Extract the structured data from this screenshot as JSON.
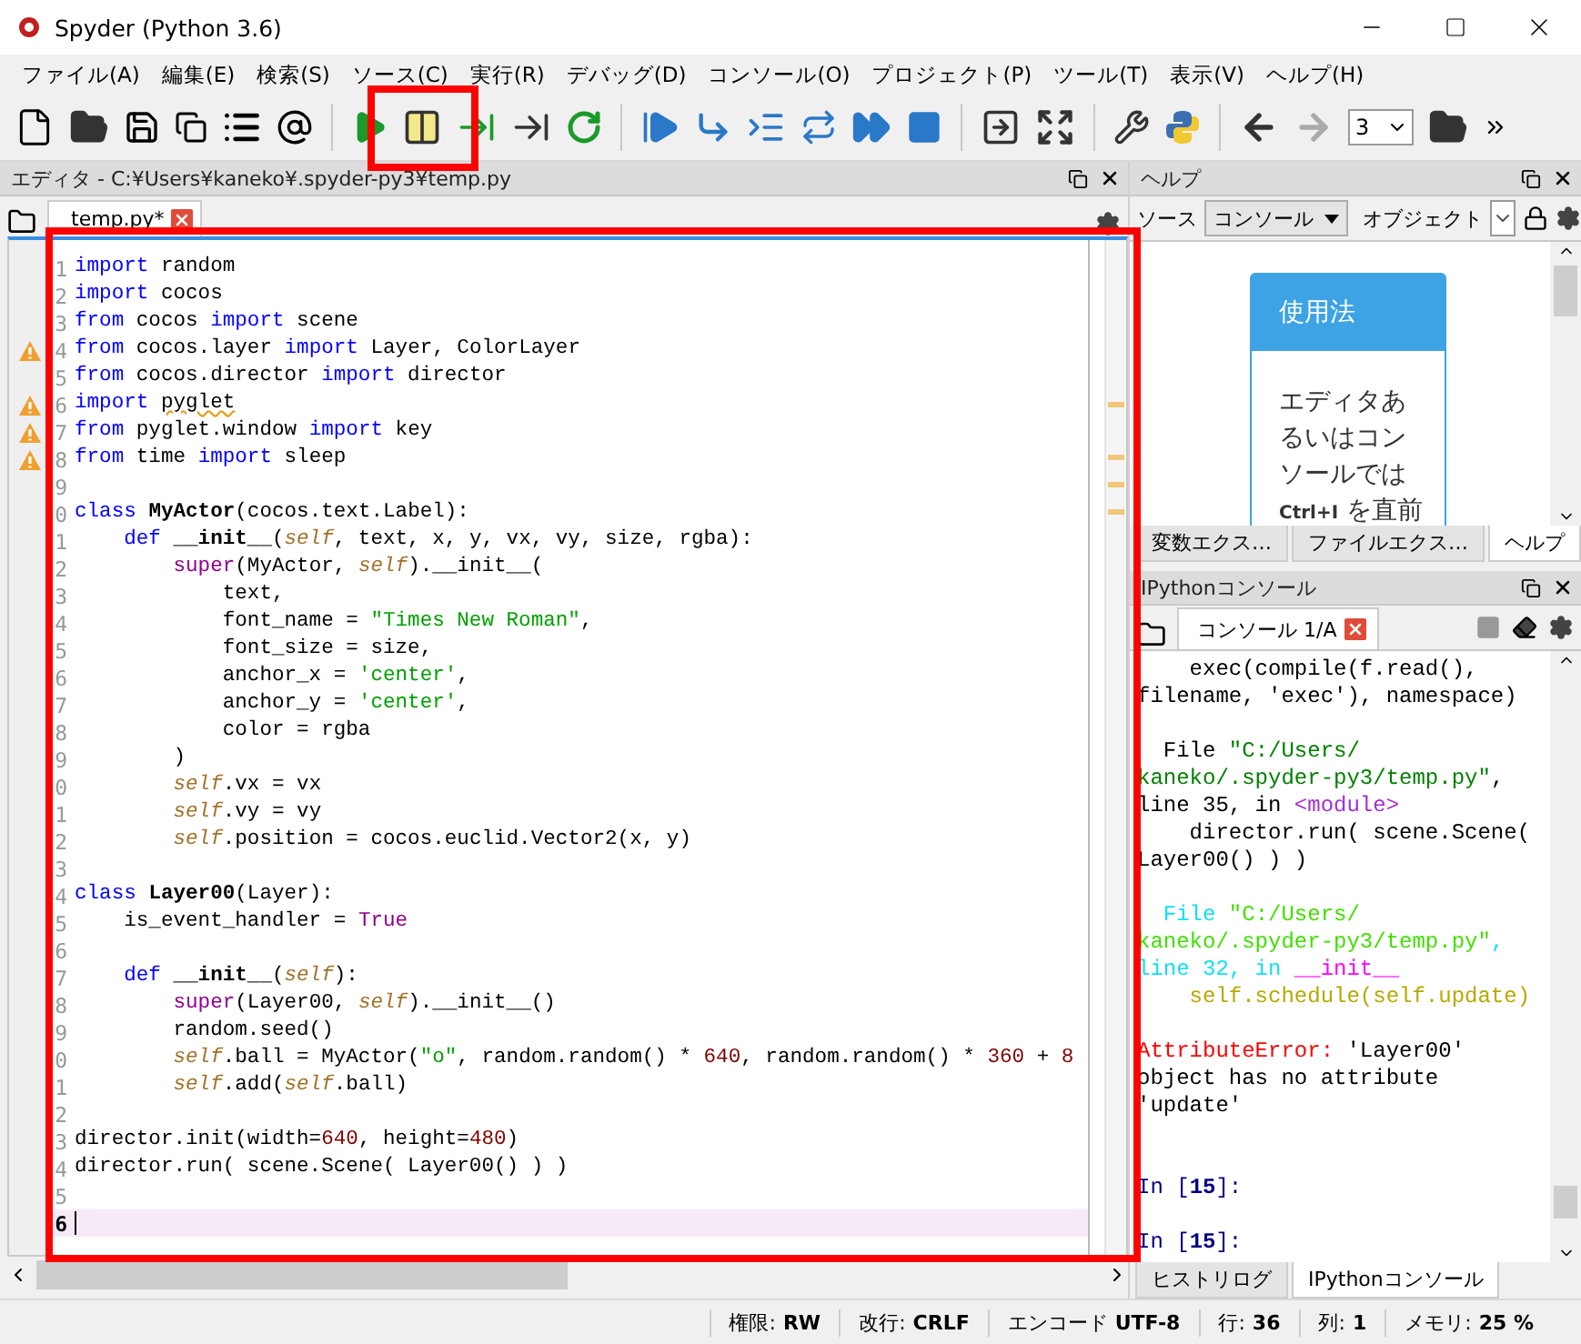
{
  "window": {
    "title": "Spyder (Python 3.6)"
  },
  "menus": [
    "ファイル(A)",
    "編集(E)",
    "検索(S)",
    "ソース(C)",
    "実行(R)",
    "デバッグ(D)",
    "コンソール(O)",
    "プロジェクト(P)",
    "ツール(T)",
    "表示(V)",
    "ヘルプ(H)"
  ],
  "toolbar": {
    "working_dir": "3"
  },
  "editor": {
    "title": "エディタ - C:¥Users¥kaneko¥.spyder-py3¥temp.py",
    "tabs": [
      {
        "label": "temp.py*",
        "selected": true
      }
    ],
    "lines": [
      {
        "number": "1",
        "warning": false,
        "current": false,
        "tokens": [
          {
            "text": "import",
            "kind": "kw"
          },
          {
            "text": " random",
            "kind": "plain"
          }
        ]
      },
      {
        "number": "2",
        "warning": false,
        "current": false,
        "tokens": [
          {
            "text": "import",
            "kind": "kw"
          },
          {
            "text": " cocos",
            "kind": "plain"
          }
        ]
      },
      {
        "number": "3",
        "warning": false,
        "current": false,
        "tokens": [
          {
            "text": "from",
            "kind": "kw"
          },
          {
            "text": " cocos ",
            "kind": "plain"
          },
          {
            "text": "import",
            "kind": "kw"
          },
          {
            "text": " scene",
            "kind": "plain"
          }
        ]
      },
      {
        "number": "4",
        "warning": true,
        "current": false,
        "tokens": [
          {
            "text": "from",
            "kind": "kw"
          },
          {
            "text": " cocos.layer ",
            "kind": "plain"
          },
          {
            "text": "import",
            "kind": "kw"
          },
          {
            "text": " Layer, ColorLayer",
            "kind": "plain"
          }
        ]
      },
      {
        "number": "5",
        "warning": false,
        "current": false,
        "tokens": [
          {
            "text": "from",
            "kind": "kw"
          },
          {
            "text": " cocos.director ",
            "kind": "plain"
          },
          {
            "text": "import",
            "kind": "kw"
          },
          {
            "text": " director",
            "kind": "plain"
          }
        ]
      },
      {
        "number": "6",
        "warning": true,
        "current": false,
        "tokens": [
          {
            "text": "import ",
            "kind": "kw"
          },
          {
            "text": "pyglet",
            "kind": "flagged"
          }
        ]
      },
      {
        "number": "7",
        "warning": true,
        "current": false,
        "tokens": [
          {
            "text": "from",
            "kind": "kw"
          },
          {
            "text": " pyglet.window ",
            "kind": "plain"
          },
          {
            "text": "import",
            "kind": "kw"
          },
          {
            "text": " key",
            "kind": "plain"
          }
        ]
      },
      {
        "number": "8",
        "warning": true,
        "current": false,
        "tokens": [
          {
            "text": "from",
            "kind": "kw"
          },
          {
            "text": " time ",
            "kind": "plain"
          },
          {
            "text": "import",
            "kind": "kw"
          },
          {
            "text": " sleep",
            "kind": "plain"
          }
        ]
      },
      {
        "number": "9",
        "warning": false,
        "current": false
      },
      {
        "number": "0",
        "warning": false,
        "current": false,
        "tokens": [
          {
            "text": "class ",
            "kind": "kw"
          },
          {
            "text": "MyActor",
            "kind": "def"
          },
          {
            "text": "(cocos.text.Label):",
            "kind": "plain"
          }
        ]
      },
      {
        "number": "1",
        "warning": false,
        "current": false,
        "tokens": [
          {
            "text": "    def ",
            "kind": "kw"
          },
          {
            "text": "__init__",
            "kind": "def"
          },
          {
            "text": "(",
            "kind": "plain"
          },
          {
            "text": "self",
            "kind": "self"
          },
          {
            "text": ", text, x, y, vx, vy, size, rgba):",
            "kind": "plain"
          }
        ]
      },
      {
        "number": "2",
        "warning": false,
        "current": false,
        "tokens": [
          {
            "text": "        super",
            "kind": "builtin"
          },
          {
            "text": "(MyActor, ",
            "kind": "plain"
          },
          {
            "text": "self",
            "kind": "self"
          },
          {
            "text": ").__init__(",
            "kind": "plain"
          }
        ]
      },
      {
        "number": "3",
        "warning": false,
        "current": false,
        "tokens": [
          {
            "text": "            text,",
            "kind": "plain"
          }
        ]
      },
      {
        "number": "4",
        "warning": false,
        "current": false,
        "tokens": [
          {
            "text": "            font_name = ",
            "kind": "plain"
          },
          {
            "text": "\"Times New Roman\"",
            "kind": "str"
          },
          {
            "text": ",",
            "kind": "plain"
          }
        ]
      },
      {
        "number": "5",
        "warning": false,
        "current": false,
        "tokens": [
          {
            "text": "            font_size = size,",
            "kind": "plain"
          }
        ]
      },
      {
        "number": "6",
        "warning": false,
        "current": false,
        "tokens": [
          {
            "text": "            anchor_x = ",
            "kind": "plain"
          },
          {
            "text": "'center'",
            "kind": "str"
          },
          {
            "text": ",",
            "kind": "plain"
          }
        ]
      },
      {
        "number": "7",
        "warning": false,
        "current": false,
        "tokens": [
          {
            "text": "            anchor_y = ",
            "kind": "plain"
          },
          {
            "text": "'center'",
            "kind": "str"
          },
          {
            "text": ",",
            "kind": "plain"
          }
        ]
      },
      {
        "number": "8",
        "warning": false,
        "current": false,
        "tokens": [
          {
            "text": "            color = rgba",
            "kind": "plain"
          }
        ]
      },
      {
        "number": "9",
        "warning": false,
        "current": false,
        "tokens": [
          {
            "text": "        )",
            "kind": "plain"
          }
        ]
      },
      {
        "number": "0",
        "warning": false,
        "current": false,
        "tokens": [
          {
            "text": "        self",
            "kind": "self"
          },
          {
            "text": ".vx = vx",
            "kind": "plain"
          }
        ]
      },
      {
        "number": "1",
        "warning": false,
        "current": false,
        "tokens": [
          {
            "text": "        self",
            "kind": "self"
          },
          {
            "text": ".vy = vy",
            "kind": "plain"
          }
        ]
      },
      {
        "number": "2",
        "warning": false,
        "current": false,
        "tokens": [
          {
            "text": "        self",
            "kind": "self"
          },
          {
            "text": ".position = cocos.euclid.Vector2(x, y)",
            "kind": "plain"
          }
        ]
      },
      {
        "number": "3",
        "warning": false,
        "current": false
      },
      {
        "number": "4",
        "warning": false,
        "current": false,
        "tokens": [
          {
            "text": "class ",
            "kind": "kw"
          },
          {
            "text": "Layer00",
            "kind": "def"
          },
          {
            "text": "(Layer):",
            "kind": "plain"
          }
        ]
      },
      {
        "number": "5",
        "warning": false,
        "current": false,
        "tokens": [
          {
            "text": "    is_event_handler = ",
            "kind": "plain"
          },
          {
            "text": "True",
            "kind": "builtin"
          }
        ]
      },
      {
        "number": "6",
        "warning": false,
        "current": false
      },
      {
        "number": "7",
        "warning": false,
        "current": false,
        "tokens": [
          {
            "text": "    def ",
            "kind": "kw"
          },
          {
            "text": "__init__",
            "kind": "def"
          },
          {
            "text": "(",
            "kind": "plain"
          },
          {
            "text": "self",
            "kind": "self"
          },
          {
            "text": "):",
            "kind": "plain"
          }
        ]
      },
      {
        "number": "8",
        "warning": false,
        "current": false,
        "tokens": [
          {
            "text": "        super",
            "kind": "builtin"
          },
          {
            "text": "(Layer00, ",
            "kind": "plain"
          },
          {
            "text": "self",
            "kind": "self"
          },
          {
            "text": ").__init__()",
            "kind": "plain"
          }
        ]
      },
      {
        "number": "9",
        "warning": false,
        "current": false,
        "tokens": [
          {
            "text": "        random.seed()",
            "kind": "plain"
          }
        ]
      },
      {
        "number": "0",
        "warning": false,
        "current": false,
        "tokens": [
          {
            "text": "        self",
            "kind": "self"
          },
          {
            "text": ".ball = MyActor(",
            "kind": "plain"
          },
          {
            "text": "\"o\"",
            "kind": "str"
          },
          {
            "text": ", random.random() * ",
            "kind": "plain"
          },
          {
            "text": "640",
            "kind": "num"
          },
          {
            "text": ", random.random() * ",
            "kind": "plain"
          },
          {
            "text": "360",
            "kind": "num"
          },
          {
            "text": " + ",
            "kind": "plain"
          },
          {
            "text": "8",
            "kind": "num"
          }
        ]
      },
      {
        "number": "1",
        "warning": false,
        "current": false,
        "tokens": [
          {
            "text": "        self",
            "kind": "self"
          },
          {
            "text": ".add(",
            "kind": "plain"
          },
          {
            "text": "self",
            "kind": "self"
          },
          {
            "text": ".ball)",
            "kind": "plain"
          }
        ]
      },
      {
        "number": "2",
        "warning": false,
        "current": false
      },
      {
        "number": "3",
        "warning": false,
        "current": false,
        "tokens": [
          {
            "text": "director.init(width=",
            "kind": "plain"
          },
          {
            "text": "640",
            "kind": "num"
          },
          {
            "text": ", height=",
            "kind": "plain"
          },
          {
            "text": "480",
            "kind": "num"
          },
          {
            "text": ")",
            "kind": "plain"
          }
        ]
      },
      {
        "number": "4",
        "warning": false,
        "current": false,
        "tokens": [
          {
            "text": "director.run( scene.Scene( Layer00() ) )",
            "kind": "plain"
          }
        ]
      },
      {
        "number": "5",
        "warning": false,
        "current": false
      },
      {
        "number": "6",
        "warning": false,
        "current": true
      }
    ]
  },
  "help": {
    "title": "ヘルプ",
    "source_label": "ソース",
    "source_value": "コンソール",
    "object_label": "オブジェクト",
    "card_title": "使用法",
    "card_text": "エディタあるいはコンソールでは**Ctrl+I** を直前",
    "tabs": [
      {
        "label": "変数エクス…",
        "selected": false
      },
      {
        "label": "ファイルエクス…",
        "selected": false
      },
      {
        "label": "ヘルプ",
        "selected": true
      }
    ]
  },
  "console": {
    "title": "IPythonコンソール",
    "tabs": [
      {
        "label": "コンソール 1/A",
        "selected": true
      }
    ],
    "lines": [
      {
        "kind": "text",
        "segments": [
          {
            "text": "    exec(compile(f.read(),",
            "kind": "plain"
          }
        ]
      },
      {
        "kind": "text",
        "segments": [
          {
            "text": "filename, 'exec'), namespace)",
            "kind": "plain"
          }
        ]
      },
      {
        "kind": "blank"
      },
      {
        "kind": "text",
        "segments": [
          {
            "text": "  File ",
            "kind": "plain"
          },
          {
            "text": "\"C:/Users/",
            "kind": "path"
          }
        ]
      },
      {
        "kind": "text",
        "segments": [
          {
            "text": "kaneko/.spyder-py3/temp.py\"",
            "kind": "path"
          },
          {
            "text": ",",
            "kind": "plain"
          }
        ]
      },
      {
        "kind": "text",
        "segments": [
          {
            "text": "line 35, in ",
            "kind": "plain"
          },
          {
            "text": "<module>",
            "kind": "module"
          }
        ]
      },
      {
        "kind": "text",
        "segments": [
          {
            "text": "    director.run( scene.Scene(",
            "kind": "plain"
          }
        ]
      },
      {
        "kind": "text",
        "segments": [
          {
            "text": "Layer00() ) )",
            "kind": "plain"
          }
        ]
      },
      {
        "kind": "blank"
      },
      {
        "kind": "text",
        "segments": [
          {
            "text": "  File ",
            "kind": "cyan"
          },
          {
            "text": "\"C:/Users/",
            "kind": "lime"
          }
        ]
      },
      {
        "kind": "text",
        "segments": [
          {
            "text": "kaneko/.spyder-py3/temp.py\"",
            "kind": "lime"
          },
          {
            "text": ",",
            "kind": "cyan"
          }
        ]
      },
      {
        "kind": "text",
        "segments": [
          {
            "text": "line 32, in ",
            "kind": "cyan"
          },
          {
            "text": "__init__",
            "kind": "magenta"
          }
        ]
      },
      {
        "kind": "text",
        "segments": [
          {
            "text": "    self.schedule(self.update)",
            "kind": "yellow"
          }
        ]
      },
      {
        "kind": "blank"
      },
      {
        "kind": "text",
        "segments": [
          {
            "text": "AttributeError: ",
            "kind": "error"
          },
          {
            "text": "'Layer00'",
            "kind": "plain"
          }
        ]
      },
      {
        "kind": "text",
        "segments": [
          {
            "text": "object has no attribute",
            "kind": "plain"
          }
        ]
      },
      {
        "kind": "text",
        "segments": [
          {
            "text": "'update'",
            "kind": "plain"
          }
        ]
      },
      {
        "kind": "blank"
      },
      {
        "kind": "blank"
      },
      {
        "kind": "text",
        "segments": [
          {
            "text": "In [",
            "kind": "prompt"
          },
          {
            "text": "15",
            "kind": "prompt-num"
          },
          {
            "text": "]:",
            "kind": "prompt"
          }
        ]
      },
      {
        "kind": "blank"
      },
      {
        "kind": "text",
        "segments": [
          {
            "text": "In [",
            "kind": "prompt"
          },
          {
            "text": "15",
            "kind": "prompt-num"
          },
          {
            "text": "]:",
            "kind": "prompt"
          }
        ]
      }
    ],
    "bottom_tabs": [
      {
        "label": "ヒストリログ",
        "selected": false
      },
      {
        "label": "IPythonコンソール",
        "selected": true
      }
    ]
  },
  "status_bar": [
    {
      "label": "権限:",
      "value": "RW"
    },
    {
      "label": "改行:",
      "value": "CRLF"
    },
    {
      "label": "エンコード",
      "value": "UTF-8"
    },
    {
      "label": "行:",
      "value": "36"
    },
    {
      "label": "列:",
      "value": "1"
    },
    {
      "label": "メモリ:",
      "value": "25 %"
    }
  ]
}
